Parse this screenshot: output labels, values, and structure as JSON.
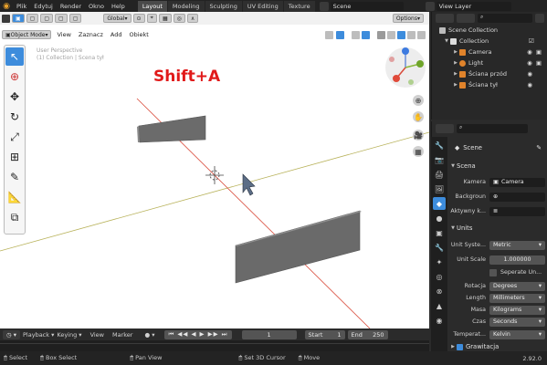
{
  "menu": [
    "Plik",
    "Edytuj",
    "Render",
    "Okno",
    "Help"
  ],
  "workspaces": [
    "Layout",
    "Modeling",
    "Sculpting",
    "UV Editing",
    "Texture"
  ],
  "scene_field": "Scene",
  "view_layer_field": "View Layer",
  "viewport_header": {
    "mode": "Object Mode",
    "menus": [
      "View",
      "Zaznacz",
      "Add",
      "Obiekt"
    ],
    "transform": "Global",
    "options": "Options"
  },
  "overlay": {
    "line1": "User Perspective",
    "line2": "(1) Collection | Scena tył"
  },
  "shortcut_hint": "Shift+A",
  "outliner": {
    "root": "Scene Collection",
    "collection": "Collection",
    "items": [
      "Camera",
      "Light",
      "Ściana przód",
      "Ściana tył"
    ]
  },
  "properties": {
    "title": "Scene",
    "scene_section": "Scena",
    "camera_label": "Kamera",
    "camera_value": "Camera",
    "background_label": "Backgroun",
    "active_label": "Aktywny k...",
    "units_section": "Units",
    "rows": [
      {
        "label": "Unit Syste...",
        "value": "Metric"
      },
      {
        "label": "Unit Scale",
        "value": "1.000000"
      },
      {
        "label": "",
        "value": "Seperate Un..."
      },
      {
        "label": "Rotacja",
        "value": "Degrees"
      },
      {
        "label": "Length",
        "value": "Millimeters"
      },
      {
        "label": "Masa",
        "value": "Kilograms"
      },
      {
        "label": "Czas",
        "value": "Seconds"
      },
      {
        "label": "Temperat...",
        "value": "Kelvin"
      }
    ],
    "gravity": "Grawitacja"
  },
  "timeline": {
    "menus": [
      "Playback",
      "Keying",
      "View",
      "Marker"
    ],
    "frame": "1",
    "start_label": "Start",
    "start": "1",
    "end_label": "End",
    "end": "250"
  },
  "status": [
    "Select",
    "Box Select",
    "Pan View",
    "Set 3D Cursor",
    "Move"
  ],
  "version": "2.92.0"
}
